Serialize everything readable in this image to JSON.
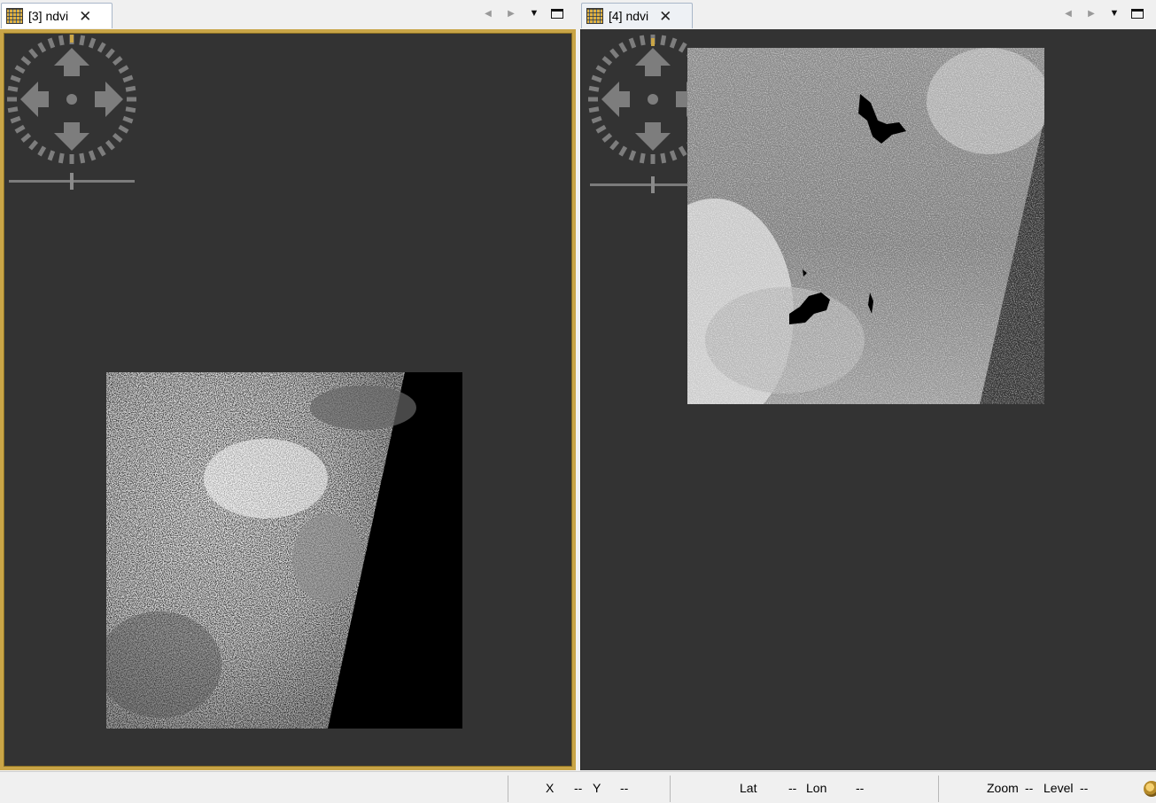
{
  "left_view": {
    "tab_label": "[3] ndvi",
    "close_glyph": "✕",
    "active": true
  },
  "right_view": {
    "tab_label": "[4] ndvi",
    "close_glyph": "✕",
    "active": false
  },
  "tab_controls": {
    "prev_glyph": "◀",
    "next_glyph": "▶",
    "menu_glyph": "▼"
  },
  "status_bar": {
    "x_label": "X",
    "x_value": "--",
    "y_label": "Y",
    "y_value": "--",
    "lat_label": "Lat",
    "lat_value": "--",
    "lon_label": "Lon",
    "lon_value": "--",
    "zoom_label": "Zoom",
    "zoom_value": "--",
    "level_label": "Level",
    "level_value": "--"
  },
  "colors": {
    "canvas_bg": "#333333",
    "active_border": "#c9a547",
    "navigation_overlay": "#8a8a8a"
  },
  "icons": {
    "tab_icon": "raster-grid-icon",
    "navigation": "pan-compass-icon",
    "zoom_slider": "zoom-slider-icon"
  }
}
